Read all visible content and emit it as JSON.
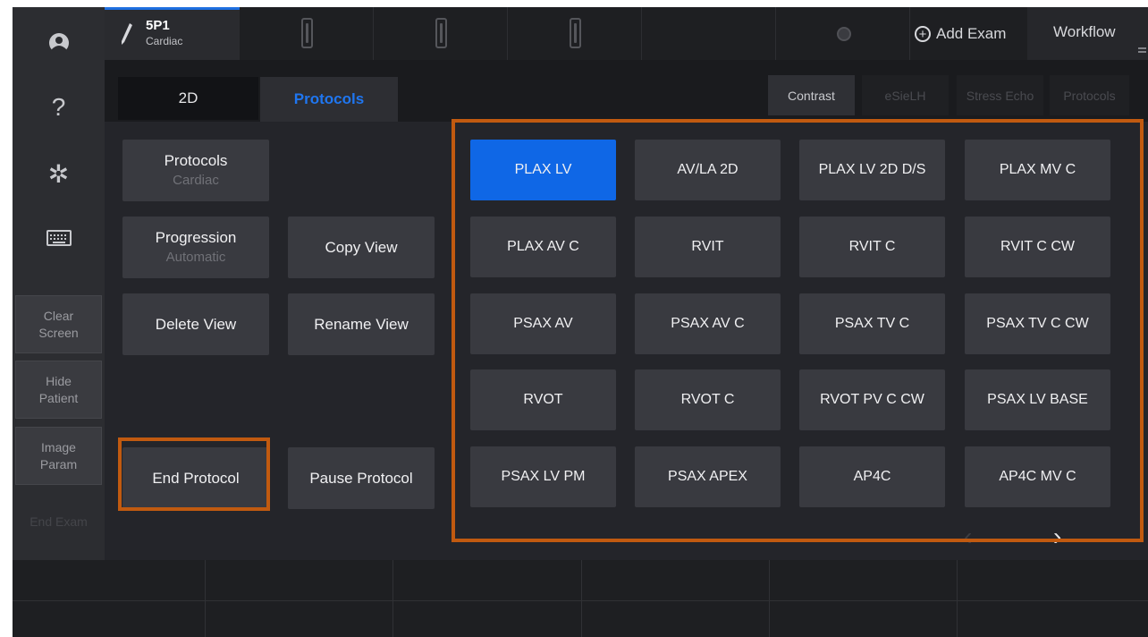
{
  "transducer": {
    "name": "5P1",
    "preset": "Cardiac"
  },
  "topbar": {
    "add_exam_label": "Add Exam",
    "workflow_label": "Workflow"
  },
  "sidebar": {
    "clear_screen": [
      "Clear",
      "Screen"
    ],
    "hide_patient": [
      "Hide",
      "Patient"
    ],
    "image_param": [
      "Image",
      "Param"
    ],
    "end_exam": "End Exam"
  },
  "tabs": {
    "tab_2d": "2D",
    "tab_protocols": "Protocols"
  },
  "mode_buttons": [
    "Contrast",
    "eSieLH",
    "Stress Echo",
    "Protocols"
  ],
  "controls": {
    "protocols": {
      "label": "Protocols",
      "value": "Cardiac"
    },
    "progression": {
      "label": "Progression",
      "value": "Automatic"
    },
    "copy_view": "Copy View",
    "delete_view": "Delete View",
    "rename_view": "Rename View",
    "end_protocol": "End Protocol",
    "pause_protocol": "Pause Protocol"
  },
  "views": [
    [
      "PLAX LV",
      "AV/LA 2D",
      "PLAX LV 2D D/S",
      "PLAX MV C"
    ],
    [
      "PLAX AV C",
      "RVIT",
      "RVIT C",
      "RVIT C CW"
    ],
    [
      "PSAX AV",
      "PSAX AV C",
      "PSAX TV C",
      "PSAX TV C CW"
    ],
    [
      "RVOT",
      "RVOT C",
      "RVOT PV C CW",
      "PSAX LV BASE"
    ],
    [
      "PSAX LV PM",
      "PSAX APEX",
      "AP4C",
      "AP4C MV C"
    ]
  ],
  "selected_view": "PLAX LV",
  "colors": {
    "accent": "#0f67e6",
    "highlight": "#c15a10",
    "tab_active_text": "#1f76f0"
  }
}
